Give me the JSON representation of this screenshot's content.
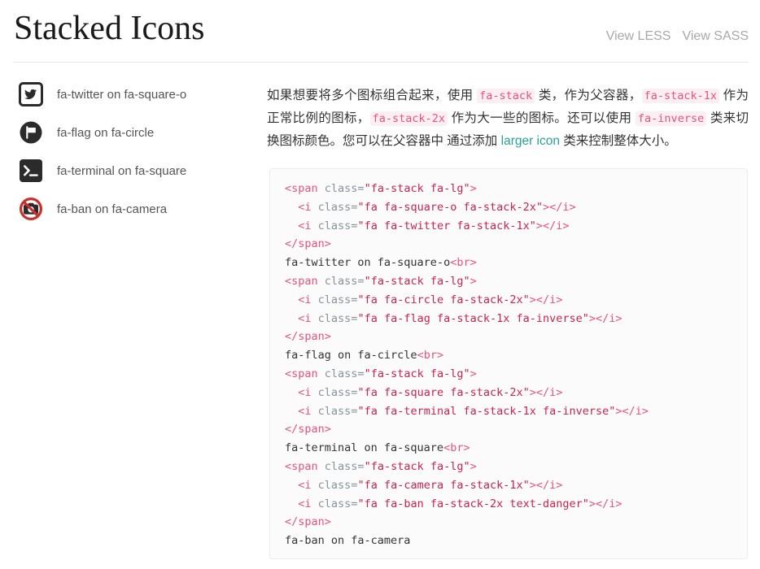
{
  "header": {
    "title": "Stacked Icons",
    "links": [
      {
        "label": "View LESS",
        "name": "view-less-link"
      },
      {
        "label": "View SASS",
        "name": "view-sass-link"
      }
    ]
  },
  "colors": {
    "accent_pink": "#e8537a",
    "code_value": "#c7254e",
    "code_attr": "#88929c",
    "link_teal": "#2aa198",
    "danger_red": "#c9302c",
    "icon_dark": "#2b2b2b",
    "text": "#333333",
    "muted": "#a8a8a8",
    "code_bg": "#fbfbfb",
    "code_border": "#ececec",
    "inline_code_bg": "#fbeff3"
  },
  "icon_list": [
    {
      "label": "fa-twitter on fa-square-o",
      "icon": "twitter-on-square-o-icon"
    },
    {
      "label": "fa-flag on fa-circle",
      "icon": "flag-on-circle-icon"
    },
    {
      "label": "fa-terminal on fa-square",
      "icon": "terminal-on-square-icon"
    },
    {
      "label": "fa-ban on fa-camera",
      "icon": "ban-on-camera-icon"
    }
  ],
  "description": {
    "part1": "如果想要将多个图标组合起来，使用 ",
    "code1": "fa-stack",
    "part2": " 类，作为父容器，",
    "code2": "fa-stack-1x",
    "part3": " 作为正常比例的图标，",
    "code3": "fa-stack-2x",
    "part4": " 作为大一些的图标。还可以使用 ",
    "code4": "fa-inverse",
    "part5": " 类来切换图标颜色。您可以在父容器中 通过添加 ",
    "link": "larger icon",
    "part6": " 类来控制整体大小。"
  },
  "code_lines": [
    [
      {
        "t": "tag",
        "s": "<span "
      },
      {
        "t": "attr",
        "s": "class="
      },
      {
        "t": "val",
        "s": "\"fa-stack fa-lg\""
      },
      {
        "t": "tag",
        "s": ">"
      }
    ],
    [
      {
        "t": "txt",
        "s": "  "
      },
      {
        "t": "tag",
        "s": "<i "
      },
      {
        "t": "attr",
        "s": "class="
      },
      {
        "t": "val",
        "s": "\"fa fa-square-o fa-stack-2x\""
      },
      {
        "t": "tag",
        "s": "></i>"
      }
    ],
    [
      {
        "t": "txt",
        "s": "  "
      },
      {
        "t": "tag",
        "s": "<i "
      },
      {
        "t": "attr",
        "s": "class="
      },
      {
        "t": "val",
        "s": "\"fa fa-twitter fa-stack-1x\""
      },
      {
        "t": "tag",
        "s": "></i>"
      }
    ],
    [
      {
        "t": "tag",
        "s": "</span>"
      }
    ],
    [
      {
        "t": "txt",
        "s": "fa-twitter on fa-square-o"
      },
      {
        "t": "tag",
        "s": "<br>"
      }
    ],
    [
      {
        "t": "tag",
        "s": "<span "
      },
      {
        "t": "attr",
        "s": "class="
      },
      {
        "t": "val",
        "s": "\"fa-stack fa-lg\""
      },
      {
        "t": "tag",
        "s": ">"
      }
    ],
    [
      {
        "t": "txt",
        "s": "  "
      },
      {
        "t": "tag",
        "s": "<i "
      },
      {
        "t": "attr",
        "s": "class="
      },
      {
        "t": "val",
        "s": "\"fa fa-circle fa-stack-2x\""
      },
      {
        "t": "tag",
        "s": "></i>"
      }
    ],
    [
      {
        "t": "txt",
        "s": "  "
      },
      {
        "t": "tag",
        "s": "<i "
      },
      {
        "t": "attr",
        "s": "class="
      },
      {
        "t": "val",
        "s": "\"fa fa-flag fa-stack-1x fa-inverse\""
      },
      {
        "t": "tag",
        "s": "></i>"
      }
    ],
    [
      {
        "t": "tag",
        "s": "</span>"
      }
    ],
    [
      {
        "t": "txt",
        "s": "fa-flag on fa-circle"
      },
      {
        "t": "tag",
        "s": "<br>"
      }
    ],
    [
      {
        "t": "tag",
        "s": "<span "
      },
      {
        "t": "attr",
        "s": "class="
      },
      {
        "t": "val",
        "s": "\"fa-stack fa-lg\""
      },
      {
        "t": "tag",
        "s": ">"
      }
    ],
    [
      {
        "t": "txt",
        "s": "  "
      },
      {
        "t": "tag",
        "s": "<i "
      },
      {
        "t": "attr",
        "s": "class="
      },
      {
        "t": "val",
        "s": "\"fa fa-square fa-stack-2x\""
      },
      {
        "t": "tag",
        "s": "></i>"
      }
    ],
    [
      {
        "t": "txt",
        "s": "  "
      },
      {
        "t": "tag",
        "s": "<i "
      },
      {
        "t": "attr",
        "s": "class="
      },
      {
        "t": "val",
        "s": "\"fa fa-terminal fa-stack-1x fa-inverse\""
      },
      {
        "t": "tag",
        "s": "></i>"
      }
    ],
    [
      {
        "t": "tag",
        "s": "</span>"
      }
    ],
    [
      {
        "t": "txt",
        "s": "fa-terminal on fa-square"
      },
      {
        "t": "tag",
        "s": "<br>"
      }
    ],
    [
      {
        "t": "tag",
        "s": "<span "
      },
      {
        "t": "attr",
        "s": "class="
      },
      {
        "t": "val",
        "s": "\"fa-stack fa-lg\""
      },
      {
        "t": "tag",
        "s": ">"
      }
    ],
    [
      {
        "t": "txt",
        "s": "  "
      },
      {
        "t": "tag",
        "s": "<i "
      },
      {
        "t": "attr",
        "s": "class="
      },
      {
        "t": "val",
        "s": "\"fa fa-camera fa-stack-1x\""
      },
      {
        "t": "tag",
        "s": "></i>"
      }
    ],
    [
      {
        "t": "txt",
        "s": "  "
      },
      {
        "t": "tag",
        "s": "<i "
      },
      {
        "t": "attr",
        "s": "class="
      },
      {
        "t": "val",
        "s": "\"fa fa-ban fa-stack-2x text-danger\""
      },
      {
        "t": "tag",
        "s": "></i>"
      }
    ],
    [
      {
        "t": "tag",
        "s": "</span>"
      }
    ],
    [
      {
        "t": "txt",
        "s": "fa-ban on fa-camera"
      }
    ]
  ]
}
